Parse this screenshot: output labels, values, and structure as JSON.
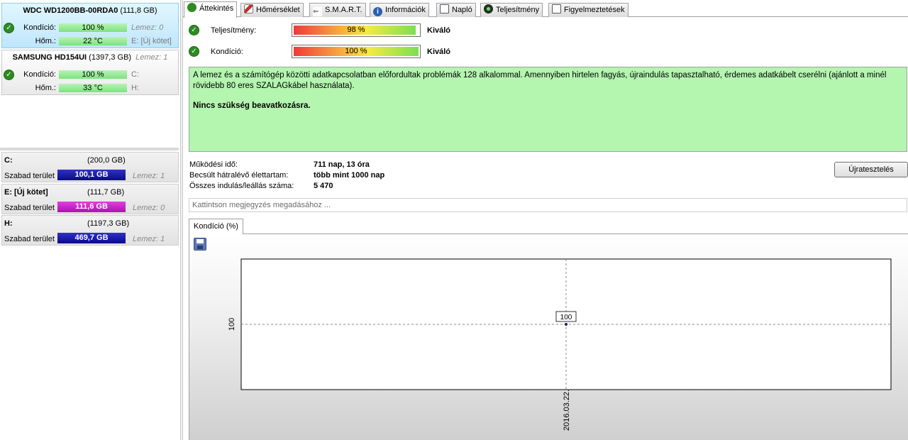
{
  "disks": [
    {
      "name": "WDC WD1200BB-00RDA0",
      "size": "(111,8 GB)",
      "extra": "",
      "health_label": "Kondíció:",
      "health_value": "100 %",
      "health_side": "Lemez: 0",
      "temp_label": "Hőm.:",
      "temp_value": "22 °C",
      "temp_side": "E: [Új kötet]"
    },
    {
      "name": "SAMSUNG HD154UI",
      "size": "(1397,3 GB)",
      "extra": "Lemez: 1",
      "health_label": "Kondíció:",
      "health_value": "100 %",
      "health_side": "C:",
      "temp_label": "Hőm.:",
      "temp_value": "33 °C",
      "temp_side": "H:"
    }
  ],
  "volumes": [
    {
      "name": "C:",
      "size": "(200,0 GB)",
      "free_label": "Szabad terület",
      "free_value": "100,1 GB",
      "bar_color": "#1a1aa8",
      "disk": "Lemez: 1"
    },
    {
      "name": "E: [Új kötet]",
      "size": "(111,7 GB)",
      "free_label": "Szabad terület",
      "free_value": "111,6 GB",
      "bar_color": "#c020c0",
      "disk": "Lemez: 0"
    },
    {
      "name": "H:",
      "size": "(1197,3 GB)",
      "free_label": "Szabad terület",
      "free_value": "469,7 GB",
      "bar_color": "#1a1aa8",
      "disk": "Lemez: 1"
    }
  ],
  "tabs": [
    {
      "label": "Áttekintés",
      "icon": "check-icon"
    },
    {
      "label": "Hőmérséklet",
      "icon": "thermometer-icon"
    },
    {
      "label": "S.M.A.R.T.",
      "icon": "smart-icon"
    },
    {
      "label": "Információk",
      "icon": "info-icon"
    },
    {
      "label": "Napló",
      "icon": "log-icon"
    },
    {
      "label": "Teljesítmény",
      "icon": "performance-icon"
    },
    {
      "label": "Figyelmeztetések",
      "icon": "alerts-icon"
    }
  ],
  "overview": {
    "performance": {
      "label": "Teljesítmény:",
      "value_text": "98 %",
      "value": 98,
      "rating": "Kiváló"
    },
    "health": {
      "label": "Kondíció:",
      "value_text": "100 %",
      "value": 100,
      "rating": "Kiváló"
    },
    "message_line1": "A lemez és a számítógép közötti adatkapcsolatban előfordultak problémák 128 alkalommal. Amennyiben hirtelen fagyás, újraindulás tapasztalható, érdemes adatkábelt cserélni (ajánlott a minél rövidebb 80 eres SZALAGkábel használata).",
    "message_line2": "Nincs szükség beavatkozásra.",
    "stats": [
      {
        "key": "Működési idő:",
        "value": "711 nap, 13 óra"
      },
      {
        "key": "Becsült hátralévő élettartam:",
        "value": "több mint 1000 nap"
      },
      {
        "key": "Összes indulás/leállás száma:",
        "value": "5 470"
      }
    ],
    "retest_button": "Újratesztelés",
    "note_placeholder": "Kattintson megjegyzés megadásához ..."
  },
  "chart_tab": "Kondíció  (%)",
  "chart_data": {
    "type": "line",
    "x": [
      "2016.03.22."
    ],
    "series": [
      {
        "values": [
          100
        ]
      }
    ],
    "xlabel": "",
    "ylabel": "",
    "y_tick_labels": [
      "100"
    ],
    "x_tick_labels": [
      "2016.03.22."
    ],
    "data_labels": [
      "100"
    ],
    "grid": true
  }
}
